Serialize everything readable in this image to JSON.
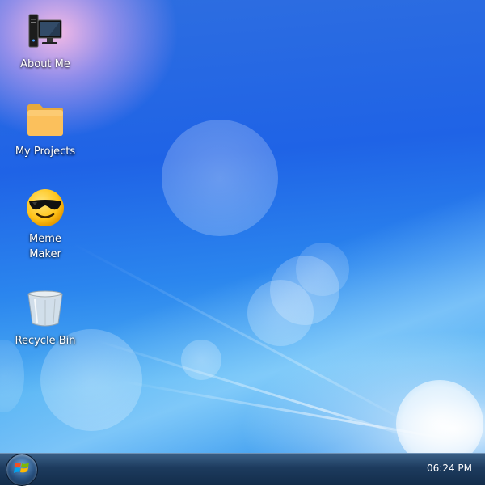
{
  "desktop": {
    "icons": [
      {
        "label": "About Me",
        "icon": "computer-monitor-icon"
      },
      {
        "label": "My Projects",
        "icon": "folder-icon"
      },
      {
        "label": "Meme\nMaker",
        "icon": "sunglasses-smiley-icon"
      },
      {
        "label": "Recycle Bin",
        "icon": "recycle-bin-icon"
      }
    ]
  },
  "taskbar": {
    "start_icon": "windows-logo-icon",
    "clock": "06:24 PM"
  },
  "colors": {
    "taskbar": "#1d3b5e",
    "wallpaper_blue": "#1f63e6"
  }
}
